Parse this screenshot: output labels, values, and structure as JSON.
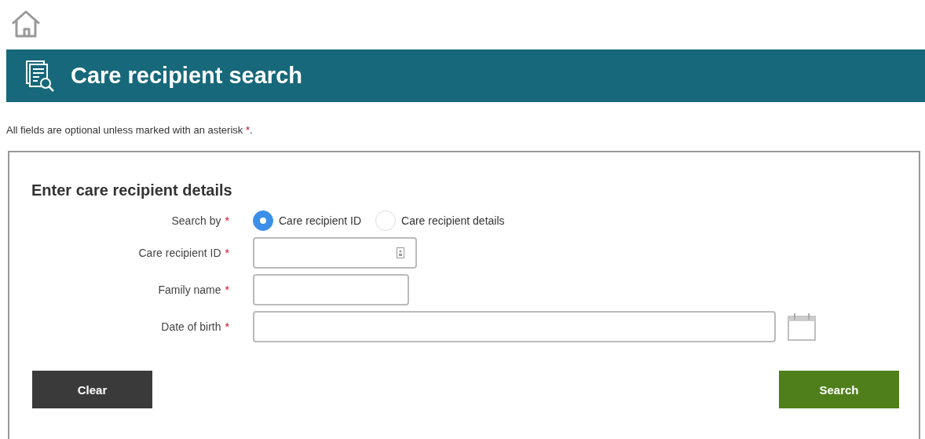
{
  "header": {
    "title": "Care recipient search"
  },
  "intro": {
    "text": "All fields are optional unless marked with an asterisk",
    "mark": "*",
    "end": "."
  },
  "form": {
    "title": "Enter care recipient details",
    "search_by": {
      "label": "Search by",
      "mark": "*",
      "options": [
        {
          "label": "Care recipient ID",
          "selected": true
        },
        {
          "label": "Care recipient details",
          "selected": false
        }
      ]
    },
    "fields": [
      {
        "kind": "id",
        "label": "Care recipient ID",
        "mark": "*"
      },
      {
        "kind": "text",
        "label": "Family name",
        "mark": "*"
      },
      {
        "kind": "date",
        "label": "Date of birth",
        "mark": "*"
      }
    ],
    "buttons": [
      {
        "kind": "secondary",
        "label": "Clear"
      },
      {
        "kind": "primary",
        "label": "Search"
      }
    ]
  }
}
